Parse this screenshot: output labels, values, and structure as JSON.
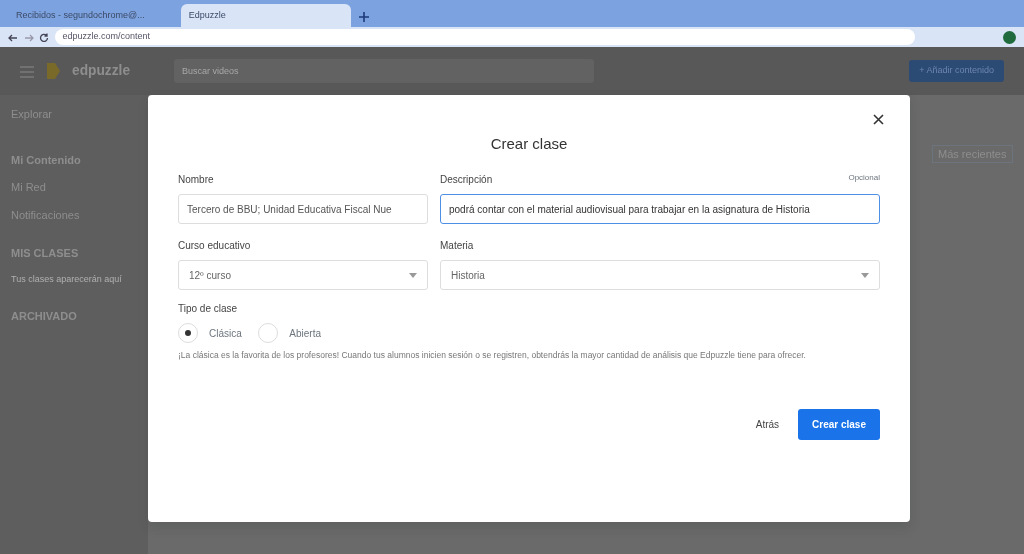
{
  "browser": {
    "tabs": [
      {
        "title": "Recibidos - segundochrome@...",
        "selected": false
      },
      {
        "title": "Edpuzzle",
        "selected": true
      }
    ],
    "url": "edpuzzle.com/content"
  },
  "app": {
    "logo": "edpuzzle",
    "search": {
      "placeholder": "Buscar videos"
    },
    "add_button": "+ Añadir contenido",
    "sidebar": [
      {
        "label": "Explorar",
        "selected": false
      },
      {
        "label": "Mi Contenido",
        "selected": true
      },
      {
        "label": "Mi Red",
        "selected": false
      },
      {
        "label": "Notificaciones",
        "selected": false
      }
    ],
    "sections": [
      {
        "heading": "MIS CLASES",
        "note": "Tus clases aparecerán aquí"
      },
      {
        "heading": "ARCHIVADO"
      }
    ],
    "sort": "Más recientes"
  },
  "dialog": {
    "title": "Crear clase",
    "name": {
      "label": "Nombre",
      "value": "Tercero de BBU; Unidad Educativa Fiscal Nue"
    },
    "description": {
      "label": "Descripción",
      "optional": "Opcional",
      "value": "podrá contar con el material audiovisual para trabajar en la asignatura de Historia"
    },
    "grade": {
      "label": "Curso educativo",
      "value": "12º curso"
    },
    "subject": {
      "label": "Materia",
      "value": "Historia"
    },
    "type": {
      "label": "Tipo de clase",
      "options": [
        {
          "label": "Clásica",
          "selected": true
        },
        {
          "label": "Abierta",
          "selected": false
        }
      ]
    },
    "help": "¡La clásica es la favorita de los profesores! Cuando tus alumnos inicien sesión o se registren, obtendrás la mayor cantidad de análisis que Edpuzzle tiene para ofrecer.",
    "buttons": [
      {
        "label": "Atrás",
        "kind": "secondary"
      },
      {
        "label": "Crear clase",
        "kind": "primary"
      }
    ]
  }
}
